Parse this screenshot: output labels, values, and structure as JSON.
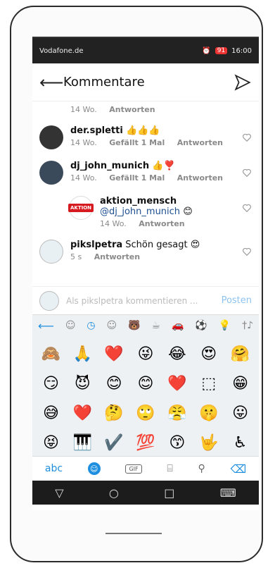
{
  "statusbar": {
    "carrier": "Vodafone.de",
    "battery": "91",
    "time": "16:00"
  },
  "header": {
    "title": "Kommentare"
  },
  "comments": [
    {
      "user": "",
      "text": "",
      "time": "14 Wo.",
      "likes": "",
      "reply": "Antworten"
    },
    {
      "user": "der.spletti",
      "text": "👍👍👍",
      "time": "14 Wo.",
      "likes": "Gefällt 1 Mal",
      "reply": "Antworten"
    },
    {
      "user": "dj_john_munich",
      "text": "👍❣️",
      "time": "14 Wo.",
      "likes": "Gefällt 1 Mal",
      "reply": "Antworten"
    },
    {
      "user": "aktion_mensch",
      "mention": "@dj_john_munich",
      "text": "😊",
      "time": "14 Wo.",
      "likes": "",
      "reply": "Antworten"
    },
    {
      "user": "pikslpetra",
      "text": "Schön gesagt 😍",
      "time": "5 s",
      "likes": "",
      "reply": "Antworten"
    }
  ],
  "input": {
    "placeholder": "Als pikslpetra kommentieren ...",
    "post": "Posten"
  },
  "emoji_tabs": [
    "⟵",
    "☺",
    "◷",
    "☺",
    "🐻",
    "☕",
    "🚗",
    "⚽",
    "💡",
    "†♪"
  ],
  "emojis": [
    "🙈",
    "🙏",
    "❤️",
    "😜",
    "😂",
    "😍",
    "🤗",
    "😏",
    "😈",
    "😊",
    "😊",
    "❤️",
    "⬚",
    "😁",
    "😅",
    "❤️",
    "🤔",
    "🙄",
    "😤",
    "🤫",
    "😛",
    "😝",
    "🎹",
    "✔️",
    "💯",
    "😙",
    "🤟",
    "♿"
  ],
  "keyboard": {
    "abc": "abc",
    "gif": "GIF"
  }
}
